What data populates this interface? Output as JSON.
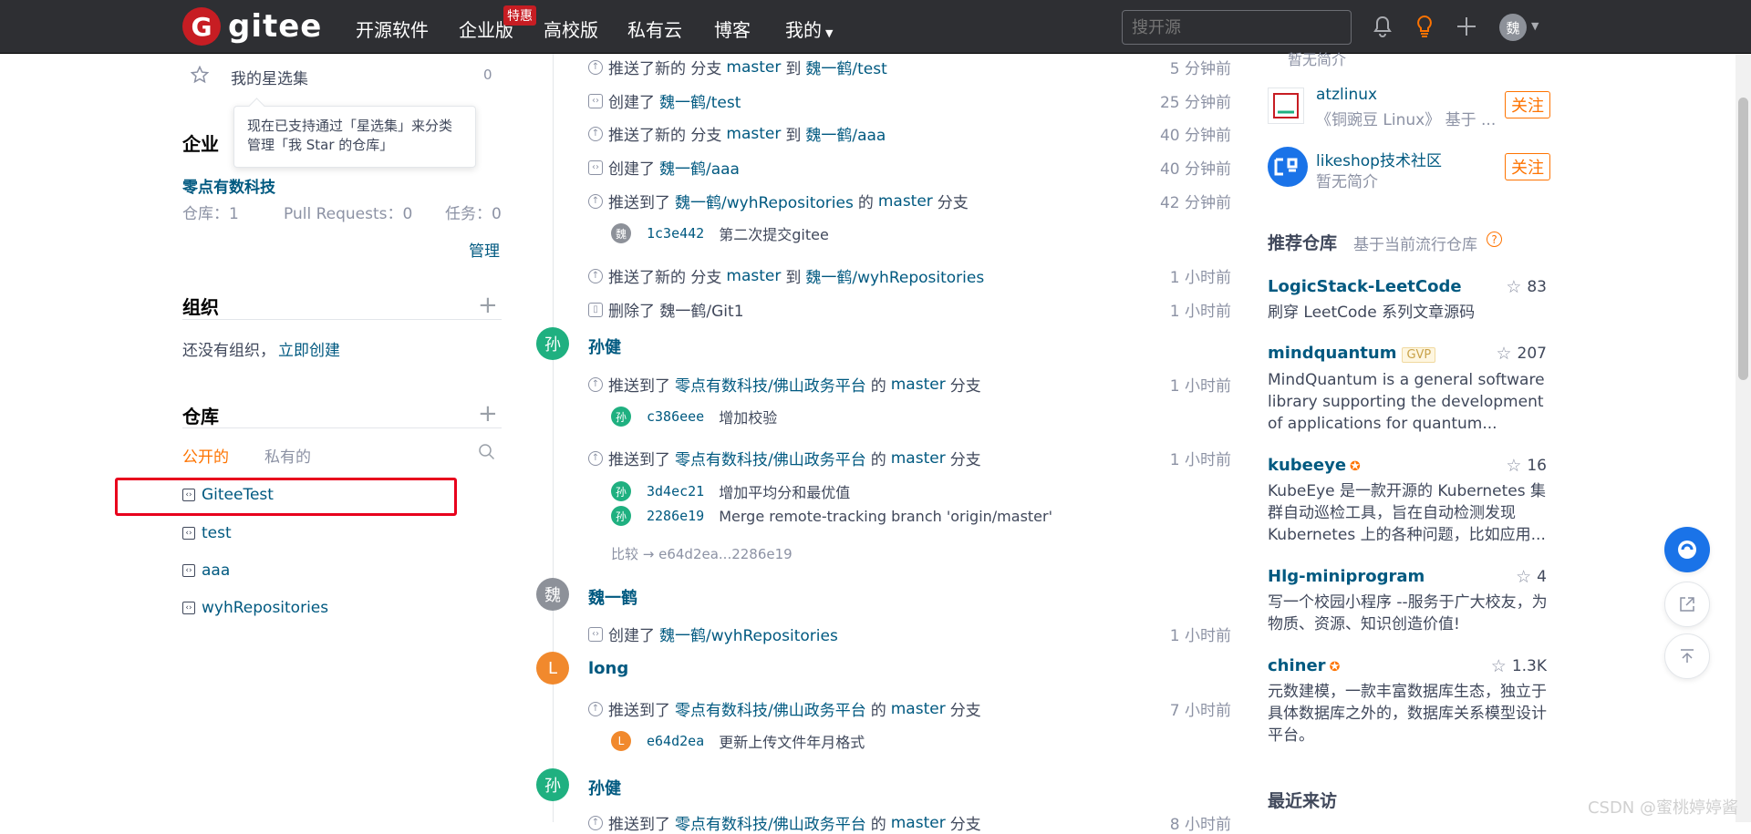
{
  "topnav": {
    "logo_mark": "G",
    "logo_text": "gitee",
    "links": [
      "开源软件",
      "企业版",
      "高校版",
      "私有云",
      "博客",
      "我的"
    ],
    "promo_badge": "特惠",
    "search_placeholder": "搜开源",
    "avatar_initial": "魏",
    "icons": [
      "bell-icon",
      "lightbulb-icon",
      "plus-icon",
      "chevron-down-icon"
    ]
  },
  "left": {
    "starred": {
      "label": "我的星选集",
      "count": "0"
    },
    "tooltip": "现在已支持通过「星选集」来分类管理「我 Star 的仓库」",
    "enterprise": {
      "title": "企业",
      "name": "零点有数科技",
      "repos": "仓库：1",
      "prs": "Pull Requests：0",
      "tasks": "任务：0",
      "manage": "管理"
    },
    "org": {
      "title": "组织",
      "empty_text": "还没有组织，",
      "create_link": "立即创建"
    },
    "repos": {
      "title": "仓库",
      "tab_public": "公开的",
      "tab_private": "私有的",
      "items": [
        "GiteeTest",
        "test",
        "aaa",
        "wyhRepositories"
      ]
    }
  },
  "feed": {
    "events": [
      {
        "action": "推送了新的 分支",
        "branch": "master",
        "mid": "到",
        "target": "魏一鹤/test",
        "suffix": "",
        "time": "5 分钟前",
        "icon": "push"
      },
      {
        "action": "创建了",
        "branch": "",
        "mid": "",
        "target": "魏一鹤/test",
        "suffix": "",
        "time": "25 分钟前",
        "icon": "repo"
      },
      {
        "action": "推送了新的 分支",
        "branch": "master",
        "mid": "到",
        "target": "魏一鹤/aaa",
        "suffix": "",
        "time": "40 分钟前",
        "icon": "push"
      },
      {
        "action": "创建了",
        "branch": "",
        "mid": "",
        "target": "魏一鹤/aaa",
        "suffix": "",
        "time": "40 分钟前",
        "icon": "repo"
      },
      {
        "action": "推送到了",
        "branch": "",
        "mid": "",
        "target": "魏一鹤/wyhRepositories",
        "suffix2": "的",
        "branch2": "master",
        "suffix": "分支",
        "time": "42 分钟前",
        "icon": "push"
      }
    ],
    "commit1": {
      "avatar": "魏",
      "sha": "1c3e442",
      "msg": "第二次提交gitee"
    },
    "event6": {
      "action": "推送了新的 分支",
      "branch": "master",
      "mid": "到",
      "target": "魏一鹤/wyhRepositories",
      "time": "1 小时前"
    },
    "event7": {
      "action": "删除了 魏一鹤/Git1",
      "time": "1 小时前"
    },
    "user_sunjian": {
      "avatar": "孙",
      "name": "孙健"
    },
    "event8": {
      "action": "推送到了",
      "target": "零点有数科技/佛山政务平台",
      "de": "的",
      "branch": "master",
      "suffix": "分支",
      "time": "1 小时前"
    },
    "commit2": {
      "avatar": "孙",
      "sha": "c386eee",
      "msg": "增加校验"
    },
    "event9": {
      "action": "推送到了",
      "target": "零点有数科技/佛山政务平台",
      "de": "的",
      "branch": "master",
      "suffix": "分支",
      "time": "1 小时前"
    },
    "commit3": {
      "avatar": "孙",
      "sha": "3d4ec21",
      "msg": "增加平均分和最优值"
    },
    "commit4": {
      "avatar": "孙",
      "sha": "2286e19",
      "msg": "Merge remote-tracking branch 'origin/master'"
    },
    "compare": "比较 → e64d2ea...2286e19",
    "user_wei": {
      "avatar": "魏",
      "name": "魏一鹤"
    },
    "event10": {
      "action": "创建了",
      "target": "魏一鹤/wyhRepositories",
      "time": "1 小时前"
    },
    "user_long": {
      "avatar": "L",
      "name": "long"
    },
    "event11": {
      "action": "推送到了",
      "target": "零点有数科技/佛山政务平台",
      "de": "的",
      "branch": "master",
      "suffix": "分支",
      "time": "7 小时前"
    },
    "commit5": {
      "avatar": "L",
      "sha": "e64d2ea",
      "msg": "更新上传文件年月格式"
    },
    "user_sunjian2": {
      "avatar": "孙",
      "name": "孙健"
    },
    "event12": {
      "action": "推送到了",
      "target": "零点有数科技/佛山政务平台",
      "de": "的",
      "branch": "master",
      "suffix": "分支",
      "time": "8 小时前"
    }
  },
  "right": {
    "top_partial_desc": "暂无简介",
    "users": [
      {
        "name": "atzlinux",
        "desc": "《铜豌豆 Linux》 基于 ...",
        "follow": "关注",
        "logo": "atzlinux-logo"
      },
      {
        "name": "likeshop技术社区",
        "desc": "暂无简介",
        "follow": "关注",
        "logo": "likeshop-logo"
      }
    ],
    "recommended": {
      "title": "推荐仓库",
      "subtitle": "基于当前流行仓库",
      "repos": [
        {
          "name": "LogicStack-LeetCode",
          "stars": "83",
          "desc": "刷穿 LeetCode 系列文章源码"
        },
        {
          "name": "mindquantum",
          "badge": "GVP",
          "stars": "207",
          "desc": "MindQuantum is a general software library supporting the development of applications for quantum..."
        },
        {
          "name": "kubeeye",
          "stars": "16",
          "desc": "KubeEye 是一款开源的 Kubernetes 集群自动巡检工具，旨在自动检测发现 Kubernetes 上的各种问题，比如应用..."
        },
        {
          "name": "Hlg-miniprogram",
          "stars": "4",
          "desc": "写一个校园小程序 --服务于广大校友，为物质、资源、知识创造价值!"
        },
        {
          "name": "chiner",
          "stars": "1.3K",
          "desc": "元数建模，一款丰富数据库生态，独立于具体数据库之外的，数据库关系模型设计平台。"
        }
      ]
    },
    "recent_visitors": "最近来访"
  },
  "watermark": "CSDN @蜜桃婷婷酱",
  "colors": {
    "brand_red": "#c71d23",
    "link_blue": "#005980",
    "accent_orange": "#fe7300",
    "topbar_bg": "#2e2f33"
  }
}
